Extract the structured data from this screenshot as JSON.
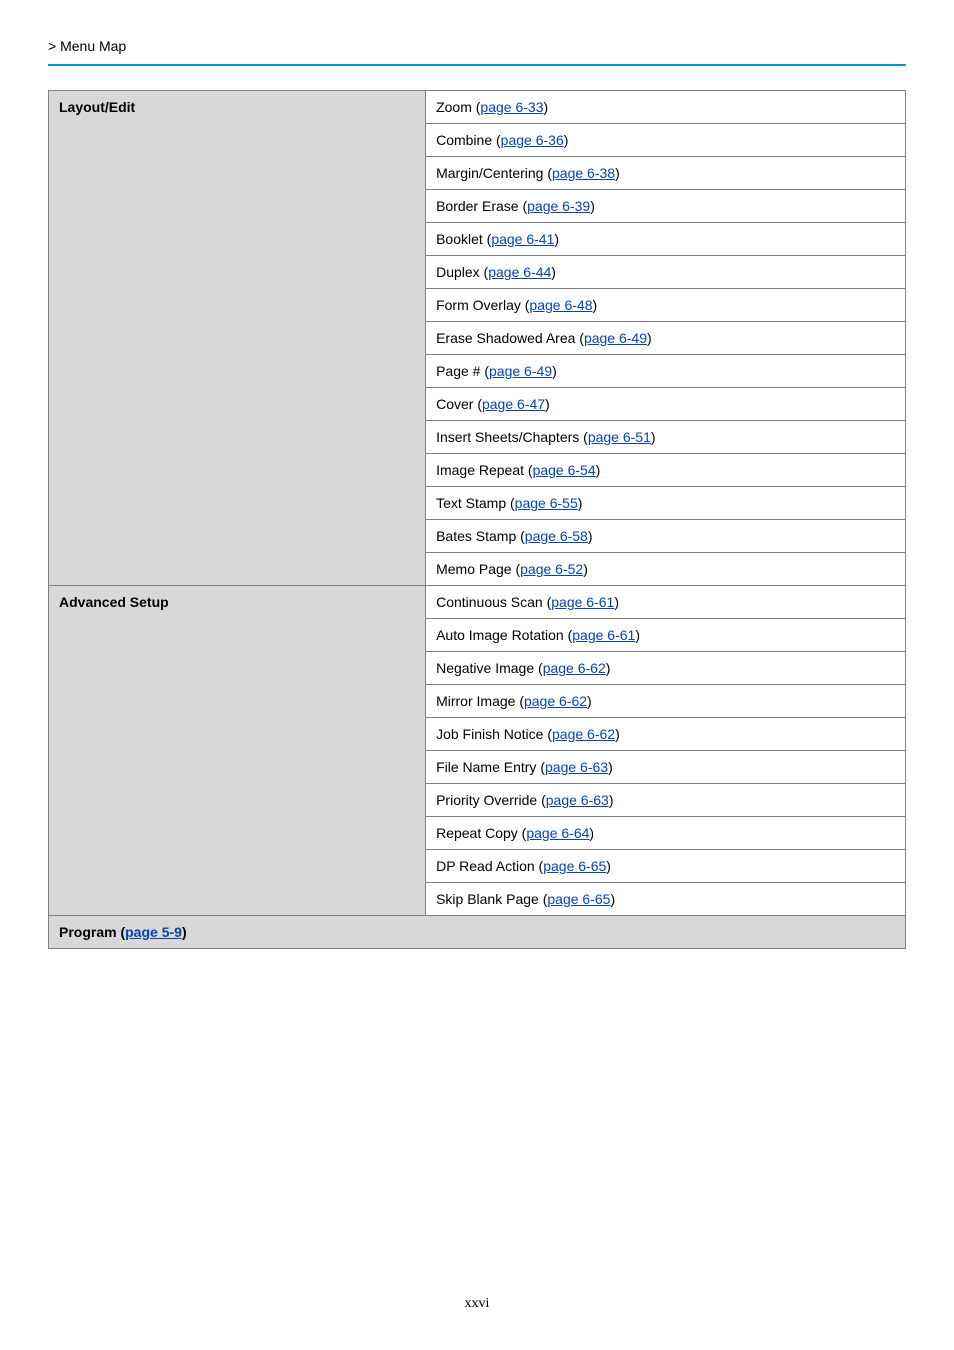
{
  "breadcrumb": {
    "prefix": "> ",
    "text": "Menu Map"
  },
  "table": {
    "groups": [
      {
        "header": "Layout/Edit",
        "header_link": null,
        "spanFull": false,
        "items": [
          {
            "text": "Zoom (",
            "link": "page 6-33",
            "suffix": ")"
          },
          {
            "text": "Combine (",
            "link": "page 6-36",
            "suffix": ")"
          },
          {
            "text": "Margin/Centering (",
            "link": "page 6-38",
            "suffix": ")"
          },
          {
            "text": "Border Erase (",
            "link": "page 6-39",
            "suffix": ")"
          },
          {
            "text": "Booklet (",
            "link": "page 6-41",
            "suffix": ")"
          },
          {
            "text": "Duplex (",
            "link": "page 6-44",
            "suffix": ")"
          },
          {
            "text": "Form Overlay (",
            "link": "page 6-48",
            "suffix": ")"
          },
          {
            "text": "Erase Shadowed Area (",
            "link": "page 6-49",
            "suffix": ")"
          },
          {
            "text": "Page # (",
            "link": "page 6-49",
            "suffix": ")"
          },
          {
            "text": "Cover (",
            "link": "page 6-47",
            "suffix": ")"
          },
          {
            "text": "Insert Sheets/Chapters (",
            "link": "page 6-51",
            "suffix": ")"
          },
          {
            "text": "Image Repeat (",
            "link": "page 6-54",
            "suffix": ")"
          },
          {
            "text": "Text Stamp (",
            "link": "page 6-55",
            "suffix": ")"
          },
          {
            "text": "Bates Stamp (",
            "link": "page 6-58",
            "suffix": ")"
          },
          {
            "text": "Memo Page (",
            "link": "page 6-52",
            "suffix": ")"
          }
        ]
      },
      {
        "header": "Advanced Setup",
        "header_link": null,
        "spanFull": false,
        "items": [
          {
            "text": "Continuous Scan (",
            "link": "page 6-61",
            "suffix": ")"
          },
          {
            "text": "Auto Image Rotation (",
            "link": "page 6-61",
            "suffix": ")"
          },
          {
            "text": "Negative Image (",
            "link": "page 6-62",
            "suffix": ")"
          },
          {
            "text": "Mirror Image (",
            "link": "page 6-62",
            "suffix": ")"
          },
          {
            "text": "Job Finish Notice (",
            "link": "page 6-62",
            "suffix": ")"
          },
          {
            "text": "File Name Entry (",
            "link": "page 6-63",
            "suffix": ")"
          },
          {
            "text": "Priority Override (",
            "link": "page 6-63",
            "suffix": ")"
          },
          {
            "text": "Repeat Copy (",
            "link": "page 6-64",
            "suffix": ")"
          },
          {
            "text": "DP Read Action (",
            "link": "page 6-65",
            "suffix": ")"
          },
          {
            "text": "Skip Blank Page (",
            "link": "page 6-65",
            "suffix": ")"
          }
        ]
      },
      {
        "header": "Program (",
        "header_link": "page 5-9",
        "header_suffix": ")",
        "spanFull": true,
        "items": []
      }
    ]
  },
  "footer": "xxvi"
}
